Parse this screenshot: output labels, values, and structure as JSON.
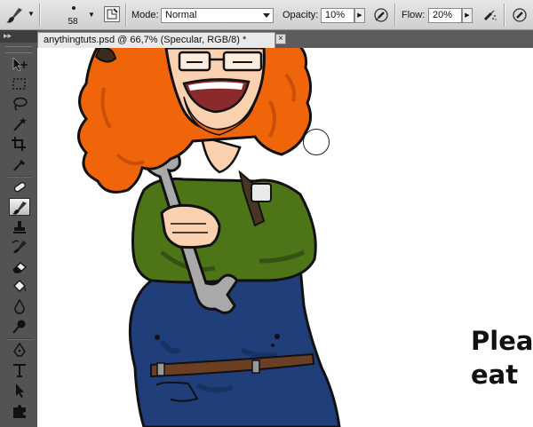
{
  "options_bar": {
    "tool_preset_icon": "brush-icon",
    "brush_size": "58",
    "mode_label": "Mode:",
    "mode_value": "Normal",
    "opacity_label": "Opacity:",
    "opacity_value": "10%",
    "flow_label": "Flow:",
    "flow_value": "20%",
    "panel_toggle_icon": "brush-panel-icon",
    "opacity_pressure_icon": "tablet-pressure-icon",
    "airbrush_icon": "airbrush-icon"
  },
  "document_tab": {
    "title": "anythingtuts.psd @ 66,7% (Specular, RGB/8) *",
    "close_label": "×"
  },
  "toolbox": {
    "collapse_label": "▸▸",
    "active_tool": "brush-tool",
    "tools": [
      "move-tool",
      "marquee-tool",
      "lasso-tool",
      "quick-selection-tool",
      "crop-tool",
      "eyedropper-tool",
      "healing-brush-tool",
      "brush-tool",
      "clone-stamp-tool",
      "history-brush-tool",
      "eraser-tool",
      "paint-bucket-tool",
      "blur-tool",
      "dodge-tool",
      "pen-tool",
      "type-tool",
      "path-selection-tool",
      "custom-shape-tool"
    ]
  },
  "canvas": {
    "text_lines": [
      "Plea",
      "eat"
    ],
    "colors": {
      "hair": "#f0650a",
      "hair_shadow": "#c94e06",
      "shirt": "#4e7418",
      "overalls": "#1f3e7a",
      "wrench": "#a9a9a9",
      "skin": "#fbd1b0",
      "belt": "#6b3f23",
      "outline": "#111111"
    }
  }
}
